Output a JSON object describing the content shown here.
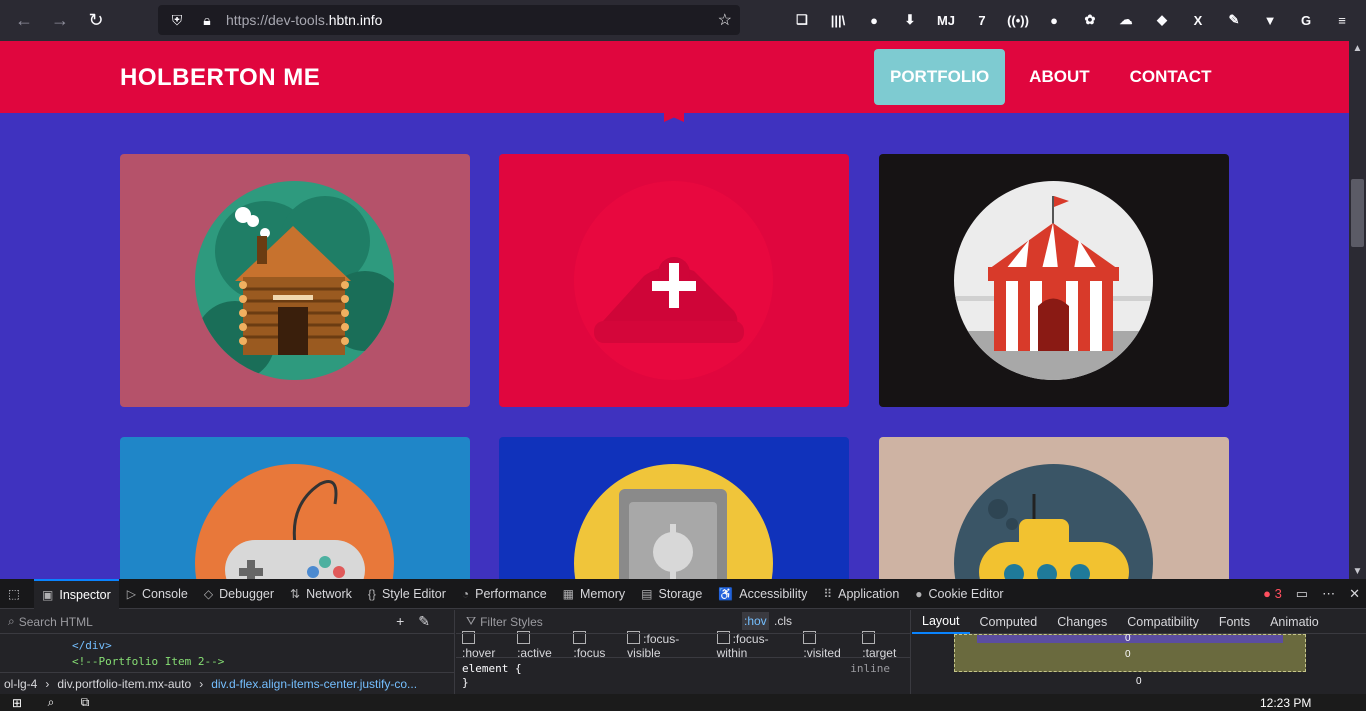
{
  "browser": {
    "url_proto": "https://dev-tools.",
    "url_host": "hbtn.info",
    "back": "←",
    "forward": "→",
    "reload": "↻",
    "toolbar_icons": [
      "❏",
      "|||\\",
      "●",
      "⬇",
      "MJ",
      "7",
      "((•))",
      "●",
      "✿",
      "☁",
      "◆",
      "X",
      "✎",
      "▼",
      "G",
      "≡"
    ]
  },
  "site": {
    "brand": "HOLBERTON ME",
    "nav": [
      {
        "label": "PORTFOLIO",
        "active": true
      },
      {
        "label": "ABOUT",
        "active": false
      },
      {
        "label": "CONTACT",
        "active": false
      }
    ],
    "accent_color": "#e0063e",
    "background_color": "#3f32bf",
    "tiles": [
      {
        "name": "cabin",
        "bg": "#b5526a",
        "icon": "log-cabin-icon"
      },
      {
        "name": "add",
        "bg": "#e0063e",
        "icon": "plus-icon",
        "overlay": "+"
      },
      {
        "name": "circus",
        "bg": "#161314",
        "icon": "circus-tent-icon"
      },
      {
        "name": "game",
        "bg": "#1f86c8",
        "icon": "game-controller-icon"
      },
      {
        "name": "safe",
        "bg": "#1032bb",
        "icon": "safe-icon"
      },
      {
        "name": "submarine",
        "bg": "#ceb3a3",
        "icon": "submarine-icon"
      }
    ]
  },
  "devtools": {
    "tabs": [
      {
        "label": "Inspector",
        "glyph": "▣",
        "active": true
      },
      {
        "label": "Console",
        "glyph": "▷",
        "active": false
      },
      {
        "label": "Debugger",
        "glyph": "◇",
        "active": false
      },
      {
        "label": "Network",
        "glyph": "⇅",
        "active": false
      },
      {
        "label": "Style Editor",
        "glyph": "{}",
        "active": false
      },
      {
        "label": "Performance",
        "glyph": "◔",
        "active": false
      },
      {
        "label": "Memory",
        "glyph": "▦",
        "active": false
      },
      {
        "label": "Storage",
        "glyph": "▤",
        "active": false
      },
      {
        "label": "Accessibility",
        "glyph": "♿",
        "active": false
      },
      {
        "label": "Application",
        "glyph": "⠿",
        "active": false
      },
      {
        "label": "Cookie Editor",
        "glyph": "●",
        "active": false
      }
    ],
    "error_count": "3",
    "search_placeholder": "Search HTML",
    "code_lines": [
      {
        "text": "</div>",
        "kind": "tag"
      },
      {
        "text": "<!--Portfolio Item 2-->",
        "kind": "comment"
      }
    ],
    "breadcrumbs": [
      "ol-lg-4",
      "div.portfolio-item.mx-auto",
      "div.d-flex.align-items-center.justify-co..."
    ],
    "filter_placeholder": "Filter Styles",
    "hov": ":hov",
    "cls": ".cls",
    "pseudo": [
      ":hover",
      ":active",
      ":focus",
      ":focus-visible",
      ":focus-within",
      ":visited",
      ":target"
    ],
    "rule_selector": "element {",
    "rule_close": "}",
    "rule_origin": "inline",
    "layout_tabs": [
      {
        "label": "Layout",
        "active": true
      },
      {
        "label": "Computed",
        "active": false
      },
      {
        "label": "Changes",
        "active": false
      },
      {
        "label": "Compatibility",
        "active": false
      },
      {
        "label": "Fonts",
        "active": false
      },
      {
        "label": "Animatio",
        "active": false
      }
    ],
    "box_values": [
      "0",
      "0",
      "0"
    ]
  },
  "taskbar": {
    "clock": "12:23 PM"
  }
}
